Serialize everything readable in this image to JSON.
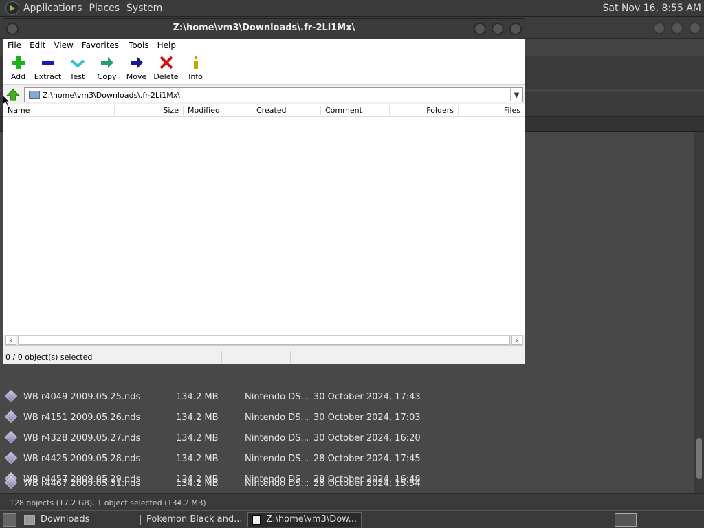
{
  "top_panel": {
    "menus": [
      "Applications",
      "Places",
      "System"
    ],
    "clock": "Sat Nov 16,  8:55 AM"
  },
  "background_files": [
    {
      "name": "WB r4049 2009.05.25.nds",
      "size": "134.2 MB",
      "type": "Nintendo DS...",
      "date": "30 October 2024, 17:43"
    },
    {
      "name": "WB r4151 2009.05.26.nds",
      "size": "134.2 MB",
      "type": "Nintendo DS...",
      "date": "30 October 2024, 17:03"
    },
    {
      "name": "WB r4328 2009.05.27.nds",
      "size": "134.2 MB",
      "type": "Nintendo DS...",
      "date": "30 October 2024, 16:20"
    },
    {
      "name": "WB r4425 2009.05.28.nds",
      "size": "134.2 MB",
      "type": "Nintendo DS...",
      "date": "28 October 2024, 17:45"
    },
    {
      "name": "WB r4457 2009.05.29.nds",
      "size": "134.2 MB",
      "type": "Nintendo DS...",
      "date": "28 October 2024, 16:48"
    },
    {
      "name": "WB r4467 2009.05.31.nds",
      "size": "134.2 MB",
      "type": "Nintendo DS...",
      "date": "28 October 2024, 15:54"
    }
  ],
  "background_status": "128 objects (17.2 GB), 1 object selected (134.2 MB)",
  "taskbar": {
    "items": [
      "Downloads",
      "Pokemon Black and...",
      "Z:\\home\\vm3\\Dow..."
    ]
  },
  "zip": {
    "title": "Z:\\home\\vm3\\Downloads\\.fr-2Li1Mx\\",
    "menu": [
      "File",
      "Edit",
      "View",
      "Favorites",
      "Tools",
      "Help"
    ],
    "toolbar": [
      {
        "label": "Add",
        "icon": "plus-icon"
      },
      {
        "label": "Extract",
        "icon": "minus-icon"
      },
      {
        "label": "Test",
        "icon": "check-icon"
      },
      {
        "label": "Copy",
        "icon": "copy-arrow-icon"
      },
      {
        "label": "Move",
        "icon": "move-arrow-icon"
      },
      {
        "label": "Delete",
        "icon": "delete-x-icon"
      },
      {
        "label": "Info",
        "icon": "info-icon"
      }
    ],
    "path": "Z:\\home\\vm3\\Downloads\\.fr-2Li1Mx\\",
    "columns": [
      "Name",
      "Size",
      "Modified",
      "Created",
      "Comment",
      "Folders",
      "Files"
    ],
    "status": "0 / 0 object(s) selected"
  },
  "colors": {
    "add": "#1db31d",
    "extract": "#1a1ab8",
    "test": "#2ec4c4",
    "copy": "#2a9a7a",
    "move": "#1a1a8a",
    "delete": "#d01010",
    "info": "#c8a800"
  }
}
